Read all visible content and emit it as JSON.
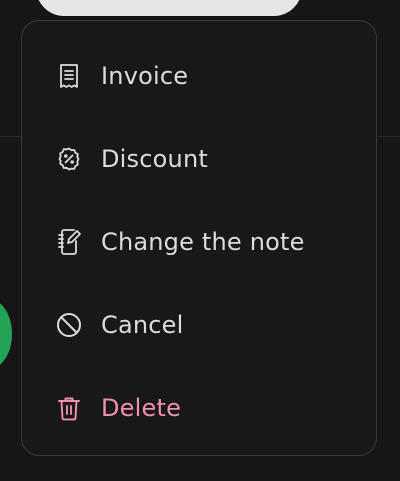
{
  "menu": {
    "items": [
      {
        "label": "Invoice",
        "icon": "receipt-icon"
      },
      {
        "label": "Discount",
        "icon": "discount-badge-icon"
      },
      {
        "label": "Change the note",
        "icon": "edit-note-icon"
      },
      {
        "label": "Cancel",
        "icon": "cancel-icon"
      },
      {
        "label": "Delete",
        "icon": "trash-icon",
        "color": "#f08eb4"
      }
    ]
  },
  "colors": {
    "background": "#161616",
    "menu_background": "#181818",
    "menu_border": "#3a3a3a",
    "text": "#dcdcdc",
    "danger": "#f08eb4",
    "accent_green": "#22a355"
  }
}
